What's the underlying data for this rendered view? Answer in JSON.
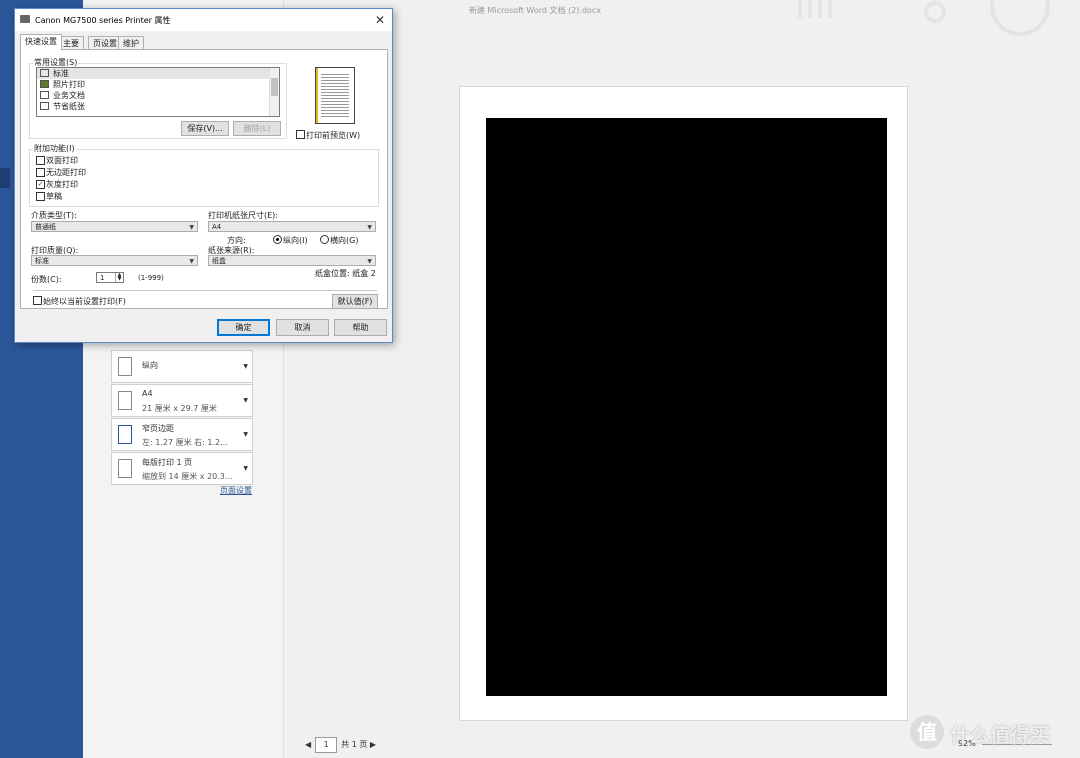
{
  "word": {
    "title": "新建 Microsoft Word 文档 (2).docx",
    "settings": [
      {
        "line1": "纵向",
        "line2": ""
      },
      {
        "line1": "A4",
        "line2": "21 厘米 x 29.7 厘米"
      },
      {
        "line1": "窄页边距",
        "line2": "左: 1.27 厘米   右: 1.2..."
      },
      {
        "line1": "每版打印 1 页",
        "line2": "缩放到 14 厘米 x 20.3..."
      }
    ],
    "page_setup_link": "页面设置",
    "pager": {
      "page": "1",
      "total_label": "共 1 页"
    },
    "zoom": "92%",
    "watermark": "什么值得买",
    "watermark_glyph": "值"
  },
  "dialog": {
    "title": "Canon MG7500 series Printer 属性",
    "close": "✕",
    "tabs": [
      "快速设置",
      "主要",
      "页设置",
      "维护"
    ],
    "common_settings_label": "常用设置(S)",
    "common_settings": [
      "标准",
      "照片打印",
      "业务文档",
      "节省纸张"
    ],
    "save_button": "保存(V)...",
    "delete_button": "删除(L)",
    "preview_before_print": "打印前预览(W)",
    "additional_features_label": "附加功能(I)",
    "features": [
      {
        "label": "双面打印",
        "checked": false
      },
      {
        "label": "无边距打印",
        "checked": false
      },
      {
        "label": "灰度打印",
        "checked": true
      },
      {
        "label": "草稿",
        "checked": false
      }
    ],
    "media_type_label": "介质类型(T):",
    "media_type_value": "普通纸",
    "paper_size_label": "打印机纸张尺寸(E):",
    "paper_size_value": "A4",
    "orientation_label": "方向:",
    "orientation_portrait": "纵向(I)",
    "orientation_landscape": "横向(G)",
    "print_quality_label": "打印质量(Q):",
    "print_quality_value": "标准",
    "paper_source_label": "纸张来源(R):",
    "paper_source_value": "纸盒",
    "paper_position": "纸盒位置:  纸盒 2",
    "copies_label": "份数(C):",
    "copies_value": "1",
    "copies_range": "(1-999)",
    "always_print_label": "始终以当前设置打印(F)",
    "defaults_button": "默认值(F)",
    "ok": "确定",
    "cancel": "取消",
    "help": "帮助"
  }
}
